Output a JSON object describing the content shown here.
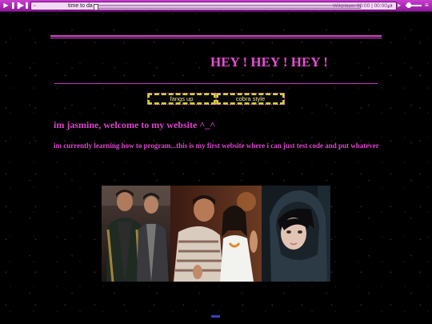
{
  "player": {
    "track_title": "time to da",
    "brand": "Wikplayer",
    "time": "00:00 | 00:00",
    "icons": [
      "play-icon",
      "pause-icon",
      "next-icon",
      "music-note-icon",
      "shuffle-icon",
      "volume-icon",
      "menu-icon"
    ],
    "progress": 0
  },
  "page": {
    "headline": "HEY ! HEY ! HEY !",
    "nav": [
      {
        "label": "fangs up"
      },
      {
        "label": "cobra style"
      }
    ],
    "welcome": "im jasmine, welcome to my website ^_^",
    "intro": "im currently learning how to program...this is my first website where i can just test code and put whatever"
  },
  "colors": {
    "background": "#000000",
    "accent": "#e94ed4",
    "player_bar": "#b02cba",
    "button_border": "#d6d32c",
    "button_text": "#e9e28a"
  },
  "photos": [
    "photo-two-men",
    "photo-couple",
    "photo-hooded-person"
  ]
}
